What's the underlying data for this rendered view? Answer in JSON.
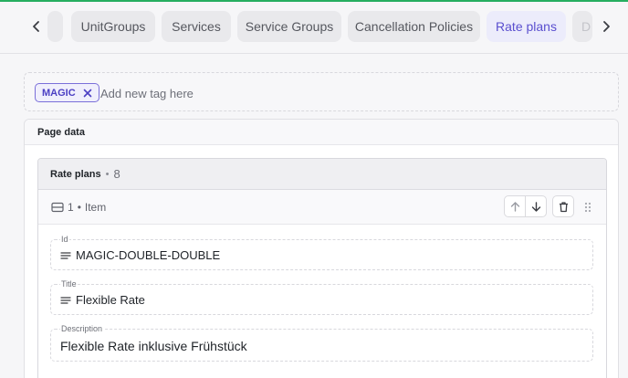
{
  "tabs": [
    {
      "label": "UnitGroups",
      "active": false
    },
    {
      "label": "Services",
      "active": false
    },
    {
      "label": "Service Groups",
      "active": false
    },
    {
      "label": "Cancellation Policies",
      "active": false
    },
    {
      "label": "Rate plans",
      "active": true
    }
  ],
  "tabs_partial": {
    "left": "",
    "right": "D"
  },
  "tags": {
    "chip": "MAGIC",
    "placeholder": "Add new tag here"
  },
  "page_data": {
    "title": "Page data",
    "group": {
      "title": "Rate plans",
      "count": "8",
      "item": {
        "index": "1",
        "label": "Item",
        "fields": {
          "id": {
            "label": "Id",
            "value": "MAGIC-DOUBLE-DOUBLE"
          },
          "title": {
            "label": "Title",
            "value": "Flexible Rate"
          },
          "description": {
            "label": "Description",
            "value": "Flexible Rate inklusive Frühstück"
          }
        }
      }
    }
  },
  "colors": {
    "accent": "#5a4fcf",
    "top_line": "#27ae60"
  },
  "icons": [
    "chevron-left-icon",
    "chevron-right-icon",
    "close-icon",
    "rows-icon",
    "arrow-up-icon",
    "arrow-down-icon",
    "trash-icon",
    "drag-handle-icon",
    "text-lines-icon"
  ]
}
